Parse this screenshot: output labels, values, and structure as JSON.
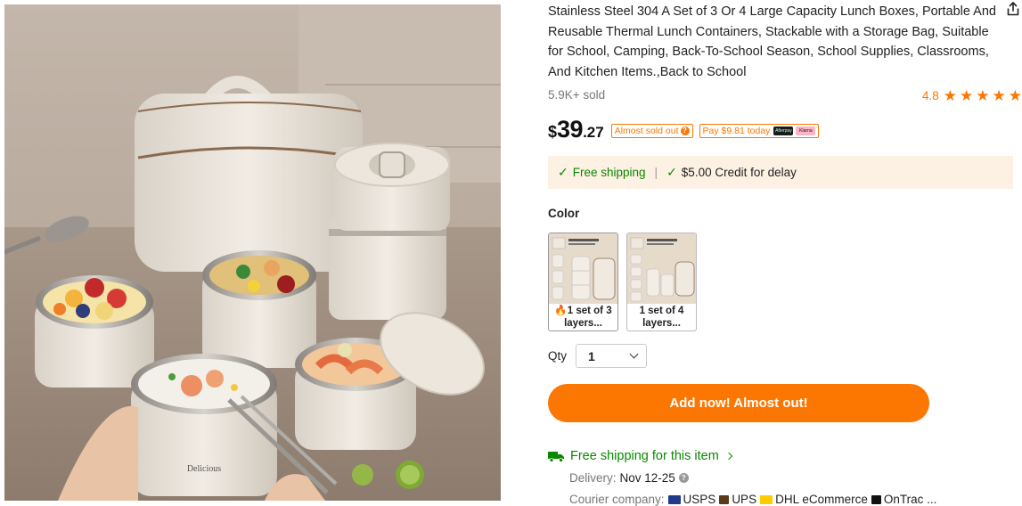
{
  "product": {
    "title": "Stainless Steel 304 A Set of 3 Or 4 Large Capacity Lunch Boxes, Portable And Reusable Thermal Lunch Containers, Stackable with a Storage Bag, Suitable for School, Camping, Back-To-School Season, School Supplies, Classrooms, And Kitchen Items.,Back to School",
    "sold": "5.9K+ sold",
    "rating": "4.8",
    "stars": 5,
    "image_brand_text": "Delicious"
  },
  "price": {
    "currency": "$",
    "integer": "39",
    "cents": ".27",
    "badge_sold_out": "Almost sold out",
    "badge_pay": "Pay $9.81 today",
    "pay_provider_1": "Afterpay",
    "pay_provider_2": "Klarna"
  },
  "shipping_banner": {
    "free_shipping": "Free shipping",
    "separator": "|",
    "credit": "$5.00 Credit for delay"
  },
  "options": {
    "color_label": "Color",
    "swatches": [
      {
        "line1": "1 set of 3",
        "line2": "layers...",
        "hot": true
      },
      {
        "line1": "1 set of 4",
        "line2": "layers...",
        "hot": false
      }
    ]
  },
  "quantity": {
    "label": "Qty",
    "value": "1"
  },
  "cta": {
    "add_label": "Add now! Almost out!"
  },
  "delivery_info": {
    "free_shipping_link": "Free shipping for this item",
    "delivery_label": "Delivery:",
    "delivery_value": "Nov 12-25",
    "courier_label": "Courier company:",
    "couriers": [
      "USPS",
      "UPS",
      "DHL eCommerce",
      "OnTrac ..."
    ]
  },
  "colors": {
    "accent": "#fb7701",
    "success": "#0a8800",
    "banner_bg": "#fdf1e4"
  },
  "icons": [
    "share-icon",
    "star-icon",
    "check-icon",
    "truck-icon",
    "chevron-down-icon",
    "chevron-right-icon",
    "question-icon",
    "fire-icon"
  ]
}
